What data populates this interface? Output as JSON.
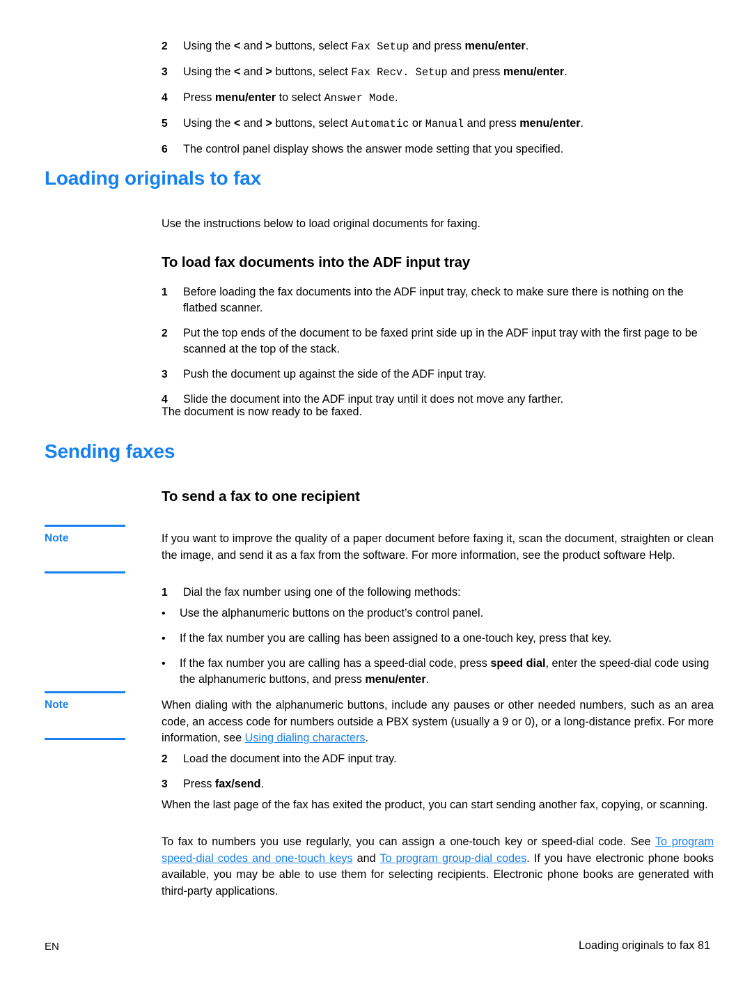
{
  "document": {
    "language_code": "EN",
    "footer_right": "Loading originals to fax 81",
    "accent_color": "#1780f0"
  },
  "top_steps": [
    {
      "number": "2",
      "parts": [
        {
          "text": "Using the ",
          "style": "normal"
        },
        {
          "text": "<",
          "style": "bold"
        },
        {
          "text": " and ",
          "style": "normal"
        },
        {
          "text": ">",
          "style": "bold"
        },
        {
          "text": " buttons, select ",
          "style": "normal"
        },
        {
          "text": "Fax Setup",
          "style": "mono"
        },
        {
          "text": " and press ",
          "style": "normal"
        },
        {
          "text": "menu/enter",
          "style": "bold"
        },
        {
          "text": ".",
          "style": "normal"
        }
      ]
    },
    {
      "number": "3",
      "parts": [
        {
          "text": "Using the ",
          "style": "normal"
        },
        {
          "text": "<",
          "style": "bold"
        },
        {
          "text": " and ",
          "style": "normal"
        },
        {
          "text": ">",
          "style": "bold"
        },
        {
          "text": " buttons, select ",
          "style": "normal"
        },
        {
          "text": "Fax Recv. Setup",
          "style": "mono"
        },
        {
          "text": " and press ",
          "style": "normal"
        },
        {
          "text": "menu/enter",
          "style": "bold"
        },
        {
          "text": ".",
          "style": "normal"
        }
      ]
    },
    {
      "number": "4",
      "parts": [
        {
          "text": "Press ",
          "style": "normal"
        },
        {
          "text": "menu/enter",
          "style": "bold"
        },
        {
          "text": " to select ",
          "style": "normal"
        },
        {
          "text": "Answer Mode",
          "style": "mono"
        },
        {
          "text": ".",
          "style": "normal"
        }
      ]
    },
    {
      "number": "5",
      "parts": [
        {
          "text": "Using the ",
          "style": "normal"
        },
        {
          "text": "<",
          "style": "bold"
        },
        {
          "text": " and ",
          "style": "normal"
        },
        {
          "text": ">",
          "style": "bold"
        },
        {
          "text": " buttons, select ",
          "style": "normal"
        },
        {
          "text": "Automatic",
          "style": "mono"
        },
        {
          "text": " or ",
          "style": "normal"
        },
        {
          "text": "Manual",
          "style": "mono"
        },
        {
          "text": " and press ",
          "style": "normal"
        },
        {
          "text": "menu/enter",
          "style": "bold"
        },
        {
          "text": ".",
          "style": "normal"
        }
      ]
    },
    {
      "number": "6",
      "parts": [
        {
          "text": "The control panel display shows the answer mode setting that you specified.",
          "style": "normal"
        }
      ]
    }
  ],
  "section_loading": {
    "heading": "Loading originals to fax",
    "intro": "Use the instructions below to load original documents for faxing.",
    "subheading": "To load fax documents into the ADF input tray",
    "steps": [
      {
        "number": "1",
        "parts": [
          {
            "text": "Before loading the fax documents into the ADF input tray, check to make sure there is nothing on the flatbed scanner.",
            "style": "normal"
          }
        ]
      },
      {
        "number": "2",
        "parts": [
          {
            "text": "Put the top ends of the document to be faxed print side up in the ADF input tray with the first page to be scanned at the top of the stack.",
            "style": "normal"
          }
        ]
      },
      {
        "number": "3",
        "parts": [
          {
            "text": "Push the document up against the side of the ADF input tray.",
            "style": "normal"
          }
        ]
      },
      {
        "number": "4",
        "parts": [
          {
            "text": "Slide the document into the ADF input tray until it does not move any farther.",
            "style": "normal"
          }
        ]
      }
    ],
    "closing": "The document is now ready to be faxed."
  },
  "section_sending": {
    "heading": "Sending faxes",
    "subheading": "To send a fax to one recipient",
    "note_1": {
      "label": "Note",
      "parts": [
        {
          "text": "If you want to improve the quality of a paper document before faxing it, scan the document, straighten or clean the image, and send it as a fax from the software. For more information, see the product software Help.",
          "style": "normal"
        }
      ]
    },
    "step_1": {
      "number": "1",
      "parts": [
        {
          "text": "Dial the fax number using one of the following methods:",
          "style": "normal"
        }
      ]
    },
    "bullets": [
      {
        "marker": "•",
        "parts": [
          {
            "text": "Use the alphanumeric buttons on the product’s control panel.",
            "style": "normal"
          }
        ]
      },
      {
        "marker": "•",
        "parts": [
          {
            "text": "If the fax number you are calling has been assigned to a one-touch key, press that key.",
            "style": "normal"
          }
        ]
      },
      {
        "marker": "•",
        "parts": [
          {
            "text": "If the fax number you are calling has a speed-dial code, press ",
            "style": "normal"
          },
          {
            "text": "speed dial",
            "style": "bold"
          },
          {
            "text": ", enter the speed-dial code using the alphanumeric buttons, and press ",
            "style": "normal"
          },
          {
            "text": "menu/enter",
            "style": "bold"
          },
          {
            "text": ".",
            "style": "normal"
          }
        ]
      }
    ],
    "note_2": {
      "label": "Note",
      "parts": [
        {
          "text": "When dialing with the alphanumeric buttons, include any pauses or other needed numbers, such as an area code, an access code for numbers outside a PBX system (usually a 9 or 0), or a long-distance prefix. For more information, see ",
          "style": "normal"
        },
        {
          "text": "Using dialing characters",
          "style": "link"
        },
        {
          "text": ".",
          "style": "normal"
        }
      ]
    },
    "steps_after_note": [
      {
        "number": "2",
        "parts": [
          {
            "text": "Load the document into the ADF input tray.",
            "style": "normal"
          }
        ]
      },
      {
        "number": "3",
        "parts": [
          {
            "text": "Press ",
            "style": "normal"
          },
          {
            "text": "fax/send",
            "style": "bold"
          },
          {
            "text": ".",
            "style": "normal"
          }
        ]
      }
    ],
    "closing_para_1": {
      "parts": [
        {
          "text": "When the last page of the fax has exited the product, you can start sending another fax, copying, or scanning.",
          "style": "normal"
        }
      ]
    },
    "closing_para_2": {
      "parts": [
        {
          "text": "To fax to numbers you use regularly, you can assign a one-touch key or speed-dial code. See ",
          "style": "normal"
        },
        {
          "text": "To program speed-dial codes and one-touch keys",
          "style": "link"
        },
        {
          "text": " and ",
          "style": "normal"
        },
        {
          "text": "To program group-dial codes",
          "style": "link"
        },
        {
          "text": ". If you have electronic phone books available, you may be able to use them for selecting recipients. Electronic phone books are generated with third-party applications.",
          "style": "normal"
        }
      ]
    }
  }
}
